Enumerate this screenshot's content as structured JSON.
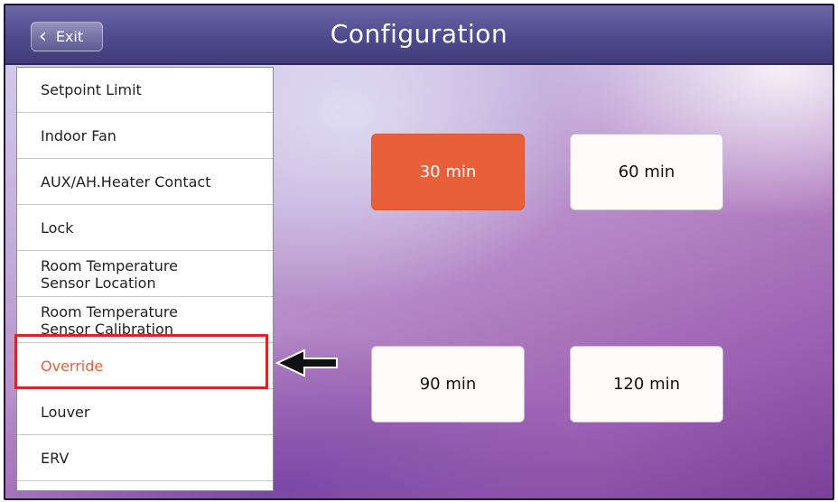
{
  "header": {
    "exit_label": "Exit",
    "title": "Configuration"
  },
  "sidebar": {
    "items": [
      {
        "label": "Setpoint Limit"
      },
      {
        "label": "Indoor Fan"
      },
      {
        "label": "AUX/AH.Heater Contact"
      },
      {
        "label": "Lock"
      },
      {
        "label": "Room Temperature Sensor Location"
      },
      {
        "label": "Room Temperature Sensor Calibration"
      },
      {
        "label": "Override",
        "active": true
      },
      {
        "label": "Louver"
      },
      {
        "label": "ERV"
      }
    ]
  },
  "options": [
    {
      "label": "30 min",
      "selected": true
    },
    {
      "label": "60 min"
    },
    {
      "label": "90 min"
    },
    {
      "label": "120 min"
    }
  ],
  "colors": {
    "accent": "#e8603a",
    "highlight": "#d7262b",
    "titlebar": "#4f4a8c"
  },
  "icons": {
    "back": "chevron-left-icon",
    "pointer": "arrow-left-icon"
  }
}
